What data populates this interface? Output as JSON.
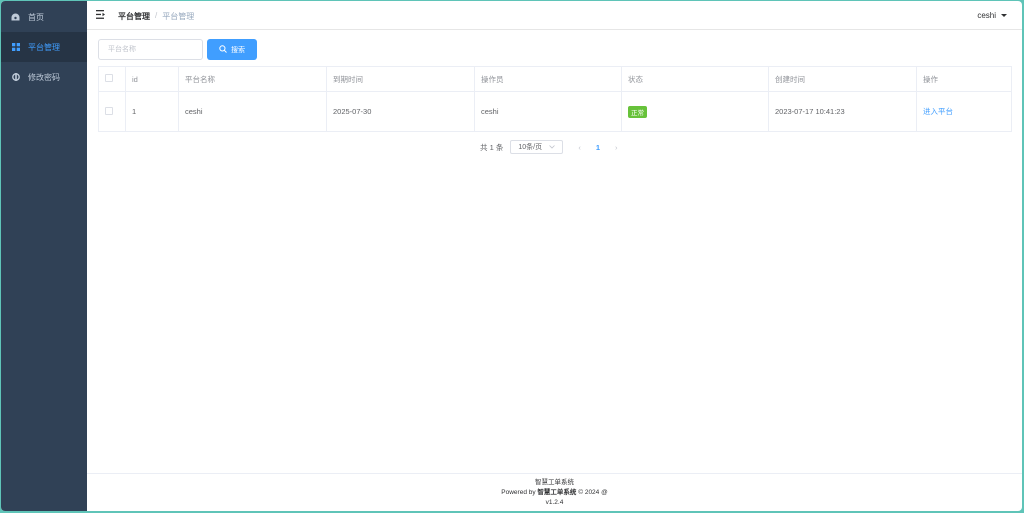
{
  "sidebar": {
    "items": [
      {
        "label": "首页",
        "icon": "dashboard-icon"
      },
      {
        "label": "平台管理",
        "icon": "grid-icon"
      },
      {
        "label": "修改密码",
        "icon": "lock-icon"
      }
    ]
  },
  "header": {
    "breadcrumb": [
      "平台管理",
      "平台管理"
    ],
    "breadcrumb_separator": "/",
    "user": "ceshi"
  },
  "search": {
    "placeholder": "平台名称",
    "value": "",
    "button_label": "搜索"
  },
  "table": {
    "columns": [
      "id",
      "平台名称",
      "到期时间",
      "操作员",
      "状态",
      "创建时间",
      "操作"
    ],
    "rows": [
      {
        "id": "1",
        "name": "ceshi",
        "expire": "2025-07-30",
        "operator": "ceshi",
        "status": "正常",
        "created": "2023-07-17 10:41:23",
        "action": "进入平台"
      }
    ]
  },
  "pagination": {
    "total_text": "共 1 条",
    "page_size": "10条/页",
    "prev": "‹",
    "current_page": "1",
    "next": "›"
  },
  "footer": {
    "line1": "智慧工单系统",
    "line2_prefix": "Powered by",
    "line2_brand": "智慧工单系统",
    "line2_suffix": "© 2024 @",
    "version": "v1.2.4"
  },
  "colors": {
    "sidebar_bg": "#304156",
    "accent": "#409eff",
    "status_ok": "#67c23a"
  }
}
